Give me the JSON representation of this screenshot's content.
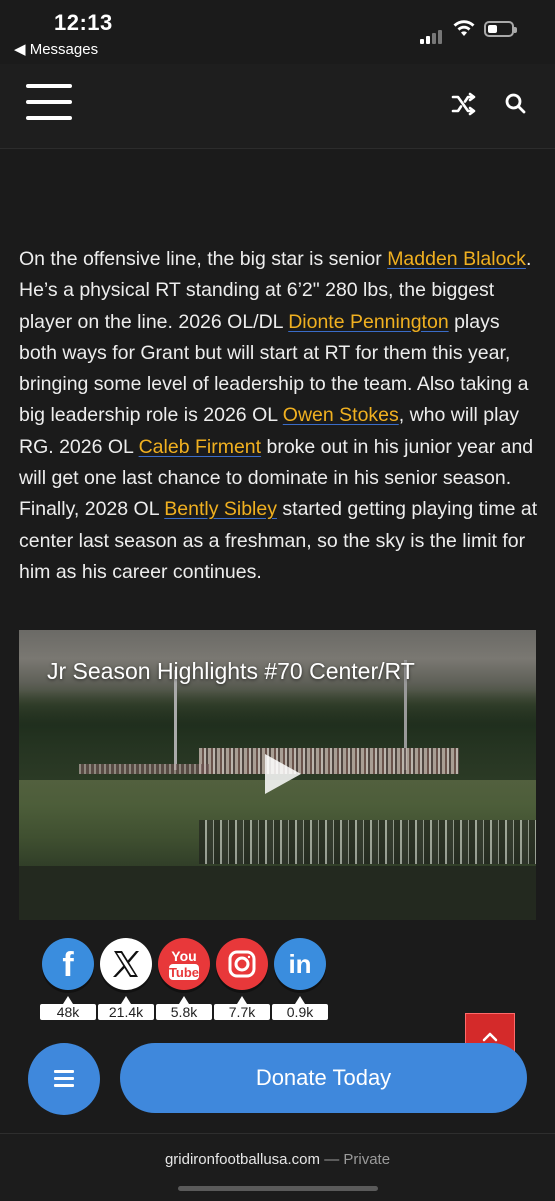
{
  "status_bar": {
    "time": "12:13",
    "back_label": "◀ Messages"
  },
  "header": {
    "menu_icon": "hamburger-icon",
    "shuffle_icon": "shuffle-icon",
    "search_icon": "search-icon"
  },
  "article": {
    "segments": [
      {
        "text": "On the offensive line, the big star is senior "
      },
      {
        "text": "Madden Blalock",
        "link": true
      },
      {
        "text": ". He’s a physical RT standing at 6’2\" 280 lbs, the biggest player on the line. 2026 OL/DL "
      },
      {
        "text": "Dionte Pennington",
        "link": true
      },
      {
        "text": " plays both ways for Grant but will start at RT for them this year, bringing some level of leadership to the team. Also taking a big leadership role is 2026 OL "
      },
      {
        "text": "Owen Stokes",
        "link": true
      },
      {
        "text": ", who will play RG. 2026 OL "
      },
      {
        "text": "Caleb Firment",
        "link": true
      },
      {
        "text": " broke out in his junior year and will get one last chance to dominate in his senior season. Finally, 2028 OL "
      },
      {
        "text": "Bently Sibley",
        "link": true
      },
      {
        "text": " started getting playing time at center last season as a freshman, so the sky is the limit for him as his career continues."
      }
    ]
  },
  "video": {
    "title": "Jr Season Highlights #70 Center/RT"
  },
  "social": [
    {
      "name": "facebook",
      "count": "48k",
      "color": "#3a8dde"
    },
    {
      "name": "x",
      "count": "21.4k",
      "color": "#ffffff"
    },
    {
      "name": "youtube",
      "count": "5.8k",
      "color": "#e8383a"
    },
    {
      "name": "instagram",
      "count": "7.7k",
      "color": "#e8383a"
    },
    {
      "name": "linkedin",
      "count": "0.9k",
      "color": "#3a8dde"
    }
  ],
  "bottom": {
    "donate_label": "Donate Today",
    "accent": "#3f88dc"
  },
  "url_bar": {
    "domain": "gridironfootballusa.com",
    "suffix": " — Private"
  }
}
